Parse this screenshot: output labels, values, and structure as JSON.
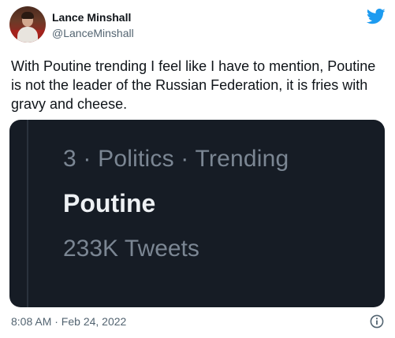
{
  "author": {
    "name": "Lance Minshall",
    "handle": "@LanceMinshall"
  },
  "tweet": {
    "text": "With Poutine trending I feel like I have to mention, Poutine is not the leader of the Russian Federation, it is fries with gravy and cheese.",
    "timestamp": "8:08 AM · Feb 24, 2022"
  },
  "trend_card": {
    "meta": "3 · Politics · Trending",
    "name": "Poutine",
    "count": "233K Tweets"
  },
  "icons": {
    "brand": "twitter-bird-icon",
    "info": "info-icon"
  },
  "colors": {
    "twitter_blue": "#1d9bf0",
    "card_background": "#161c25",
    "secondary_text": "#536471"
  }
}
